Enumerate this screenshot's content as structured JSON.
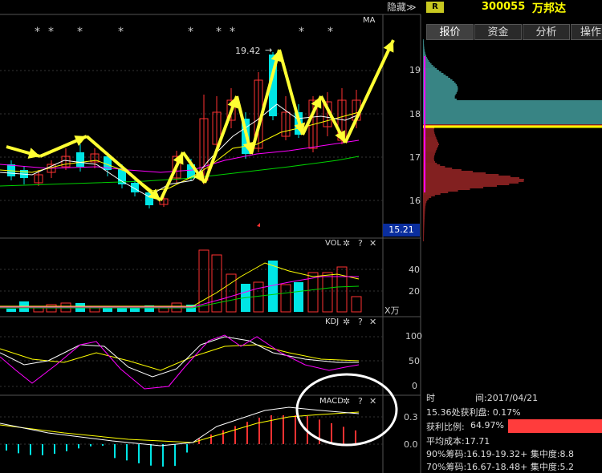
{
  "header": {
    "hide_label": "隐藏≫",
    "badge": "R",
    "stock_code": "300055",
    "stock_name": "万邦达"
  },
  "tabs": [
    {
      "label": "报价",
      "active": true
    },
    {
      "label": "资金",
      "active": false
    },
    {
      "label": "分析",
      "active": false
    },
    {
      "label": "操作",
      "active": false
    }
  ],
  "main_chart": {
    "indicator_label": "MA",
    "high_marker": "19.42",
    "price_ticks": [
      "19",
      "18",
      "17",
      "16"
    ],
    "current_price": "15.21",
    "stars": [
      "*",
      "*",
      "*",
      "*",
      "*",
      "*",
      "*",
      "*",
      "*"
    ]
  },
  "vol_pane": {
    "title": "VOL",
    "ticks": [
      "40",
      "20"
    ],
    "unit": "X万"
  },
  "kdj_pane": {
    "title": "KDJ",
    "ticks": [
      "100",
      "50",
      "0"
    ]
  },
  "macd_pane": {
    "title": "MACD",
    "ticks": [
      "0.3",
      "0.0"
    ]
  },
  "pane_icons": {
    "settings": "✲",
    "help": "?",
    "close": "✕"
  },
  "info": {
    "time_label": "时",
    "time_value": "间:2017/04/21",
    "profit_line": "15.36处获利盘: 0.17%",
    "profit_ratio_label": "获利比例:",
    "profit_ratio_value": "64.97%",
    "avg_cost": "平均成本:17.71",
    "chip90": "90%筹码:16.19-19.32+ 集中度:8.8",
    "chip70": "70%筹码:16.67-18.48+ 集中度:5.2"
  },
  "colors": {
    "up": "#ff3232",
    "down": "#00e5e5",
    "ma_white": "#ffffff",
    "ma_yellow": "#ffff00",
    "ma_magenta": "#ff00ff",
    "ma_green": "#00d000",
    "arrow": "#ffff33",
    "profit_bar": "#ff3c3c"
  }
}
